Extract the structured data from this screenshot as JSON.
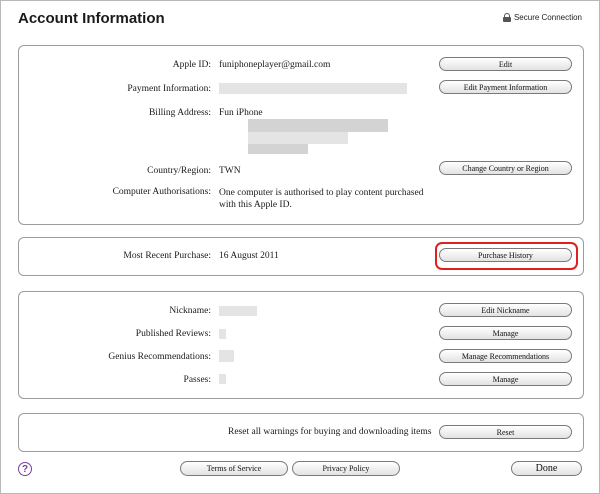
{
  "header": {
    "title": "Account Information",
    "secure_label": "Secure Connection"
  },
  "account": {
    "apple_id_label": "Apple ID:",
    "apple_id_value": "funiphoneplayer@gmail.com",
    "payment_label": "Payment Information:",
    "billing_label": "Billing Address:",
    "billing_name": "Fun iPhone",
    "country_label": "Country/Region:",
    "country_value": "TWN",
    "auth_label": "Computer Authorisations:",
    "auth_value": "One computer is authorised to play content purchased with this Apple ID.",
    "edit_button": "Edit",
    "edit_payment_button": "Edit Payment Information",
    "change_country_button": "Change Country or Region"
  },
  "purchase": {
    "label": "Most Recent Purchase:",
    "value": "16 August 2011",
    "history_button": "Purchase History"
  },
  "profile": {
    "nickname_label": "Nickname:",
    "reviews_label": "Published Reviews:",
    "genius_label": "Genius Recommendations:",
    "passes_label": "Passes:",
    "edit_nickname_button": "Edit Nickname",
    "manage_reviews_button": "Manage",
    "manage_recs_button": "Manage Recommendations",
    "manage_passes_button": "Manage"
  },
  "reset": {
    "text": "Reset all warnings for buying and downloading items",
    "button": "Reset"
  },
  "footer": {
    "help_label": "?",
    "terms_button": "Terms of Service",
    "privacy_button": "Privacy Policy",
    "done_button": "Done"
  },
  "colors": {
    "highlight": "#e02020",
    "help_purple": "#7a3fa0"
  }
}
